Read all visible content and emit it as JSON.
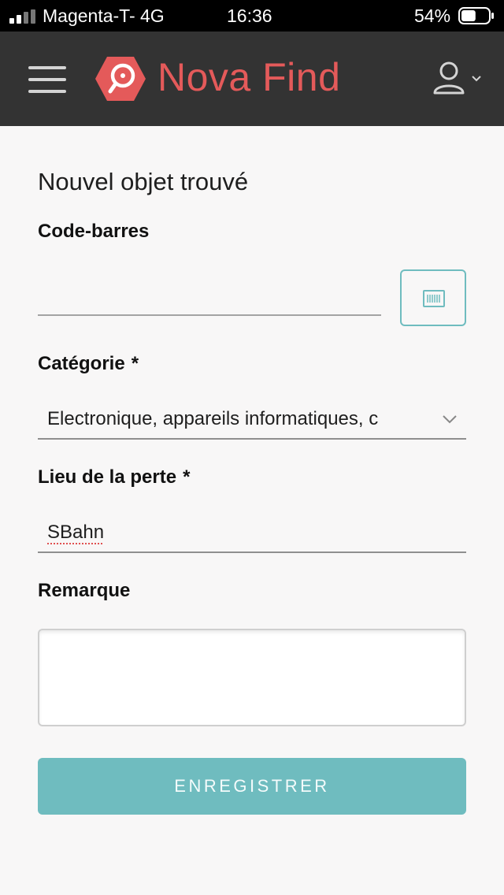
{
  "status_bar": {
    "carrier": "Magenta-T-  4G",
    "time": "16:36",
    "battery": "54%",
    "battery_level": 0.54
  },
  "header": {
    "app_name": "Nova Find",
    "brand_color": "#e45a5a",
    "background_color": "#333333",
    "menu_icon": "hamburger-menu-icon",
    "user_icon": "user-icon"
  },
  "form": {
    "title": "Nouvel objet trouvé",
    "barcode": {
      "label": "Code-barres",
      "value": "",
      "scan_icon": "barcode-scan-icon"
    },
    "category": {
      "label": "Catégorie",
      "required_mark": "*",
      "selected": "Electronique, appareils informatiques, c"
    },
    "location": {
      "label": "Lieu de la perte",
      "required_mark": "*",
      "value": "SBahn"
    },
    "remark": {
      "label": "Remarque",
      "value": ""
    },
    "submit_label": "ENREGISTRER",
    "accent_color": "#6fbcbf"
  }
}
